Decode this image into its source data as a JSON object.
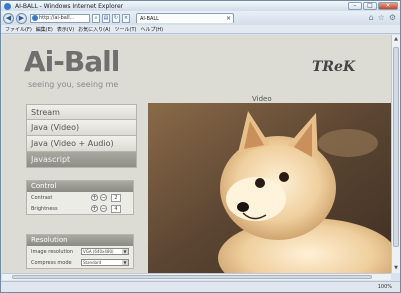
{
  "window": {
    "title": "AI-BALL - Windows Internet Explorer"
  },
  "navbar": {
    "url": "http://ai-ball...",
    "tab_title": "AI-BALL"
  },
  "menubar": {
    "items": [
      "ファイル(F)",
      "編集(E)",
      "表示(V)",
      "お気に入り(A)",
      "ツール(T)",
      "ヘルプ(H)"
    ]
  },
  "page": {
    "logo": "Ai-Ball",
    "tagline": "seeing you, seeing me",
    "brand": "TReK",
    "video_label": "Video",
    "nav": [
      "Stream",
      "Java (Video)",
      "Java (Video + Audio)",
      "Javascript"
    ],
    "control": {
      "title": "Control",
      "contrast_label": "Contrast",
      "contrast_value": "2",
      "brightness_label": "Brightness",
      "brightness_value": "4"
    },
    "resolution": {
      "title": "Resolution",
      "image_label": "Image resolution",
      "image_value": "VGA (640x480)",
      "compress_label": "Compress mode",
      "compress_value": "Standard"
    }
  },
  "status": {
    "zoom": "100%"
  }
}
